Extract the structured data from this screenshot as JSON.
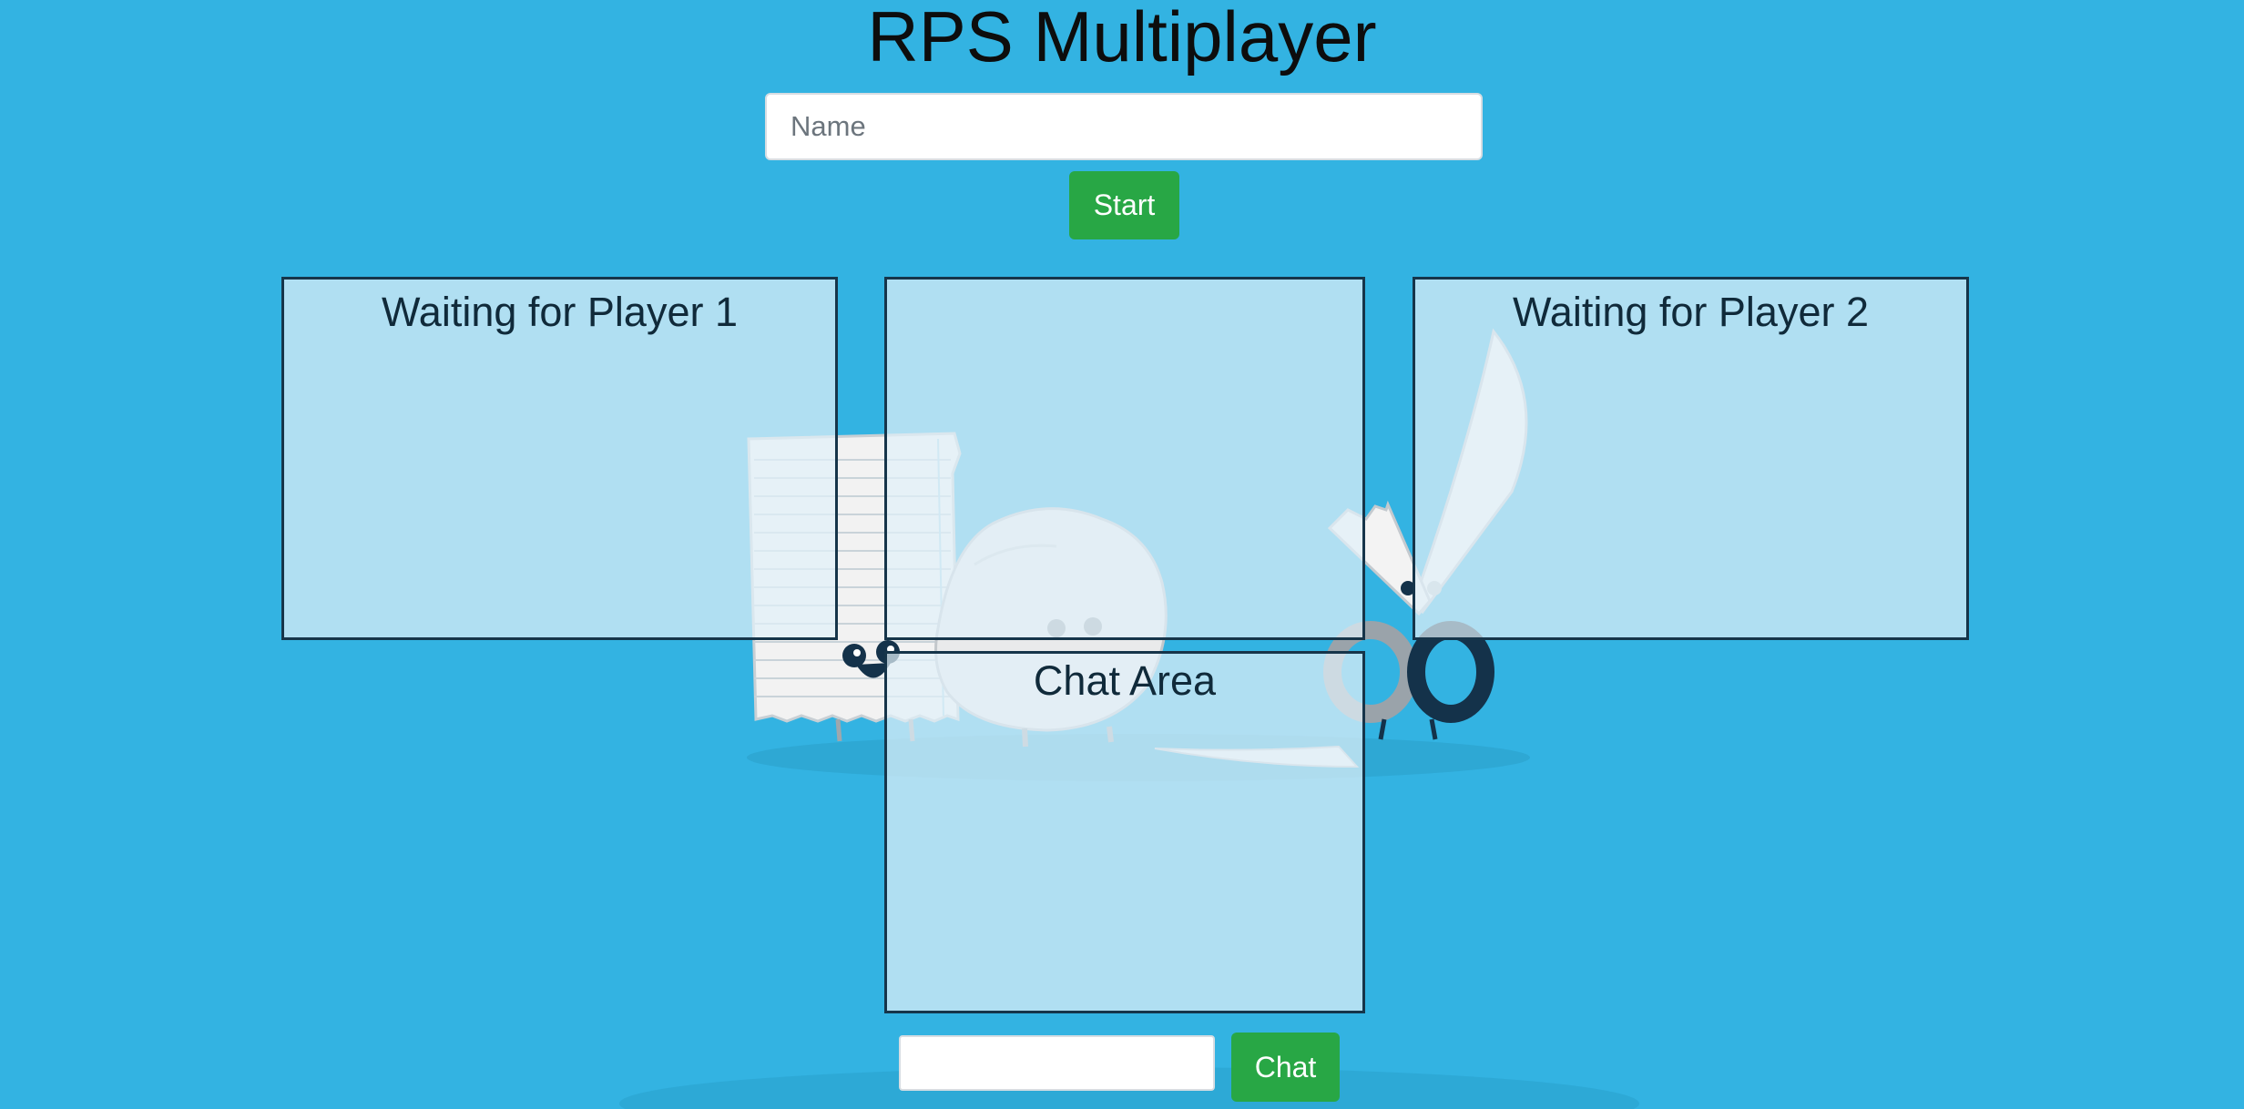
{
  "page": {
    "title": "RPS Multiplayer",
    "background_color": "#33b3e2",
    "accent_color": "#28a745"
  },
  "signup": {
    "name_placeholder": "Name",
    "name_value": "",
    "start_label": "Start"
  },
  "panels": {
    "player1": {
      "status": "Waiting for Player 1"
    },
    "game": {
      "content": ""
    },
    "player2": {
      "status": "Waiting for Player 2"
    },
    "chat": {
      "title": "Chat Area"
    }
  },
  "chat": {
    "input_value": "",
    "send_label": "Chat"
  },
  "illustration": {
    "icons": [
      "paper-character-icon",
      "rock-character-icon",
      "scissors-character-icon"
    ]
  }
}
